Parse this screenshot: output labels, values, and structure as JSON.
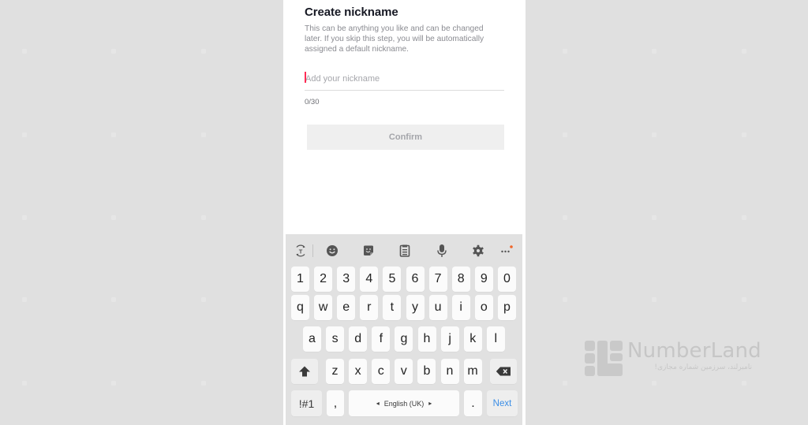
{
  "page": {
    "title": "Create nickname",
    "description": "This can be anything you like and can be changed later. If you skip this step, you will be automatically assigned a default nickname.",
    "nickname_input": {
      "value": "",
      "placeholder": "Add your nickname"
    },
    "counter": "0/30",
    "confirm_label": "Confirm"
  },
  "keyboard": {
    "toolbar_icons": [
      "text-translate-icon",
      "emoji-icon",
      "sticker-icon",
      "clipboard-icon",
      "microphone-icon",
      "settings-gear-icon",
      "more-options-icon"
    ],
    "number_row": [
      "1",
      "2",
      "3",
      "4",
      "5",
      "6",
      "7",
      "8",
      "9",
      "0"
    ],
    "row1": [
      "q",
      "w",
      "e",
      "r",
      "t",
      "y",
      "u",
      "i",
      "o",
      "p"
    ],
    "row2": [
      "a",
      "s",
      "d",
      "f",
      "g",
      "h",
      "j",
      "k",
      "l"
    ],
    "row3": [
      "z",
      "x",
      "c",
      "v",
      "b",
      "n",
      "m"
    ],
    "shift_label": "⬆",
    "backspace_label": "⌫",
    "symbols_label": "!#1",
    "comma_label": ",",
    "space_label": "English (UK)",
    "space_left_arrow": "◂",
    "space_right_arrow": "▸",
    "period_label": ".",
    "next_label": "Next"
  },
  "watermark": {
    "brand": "NumberLand",
    "tagline": "نامبرلند، سرزمین شماره مجازی!"
  },
  "colors": {
    "accent_caret": "#fe2c55",
    "next_key": "#3b8ee6",
    "notification_dot": "#f0662a"
  }
}
